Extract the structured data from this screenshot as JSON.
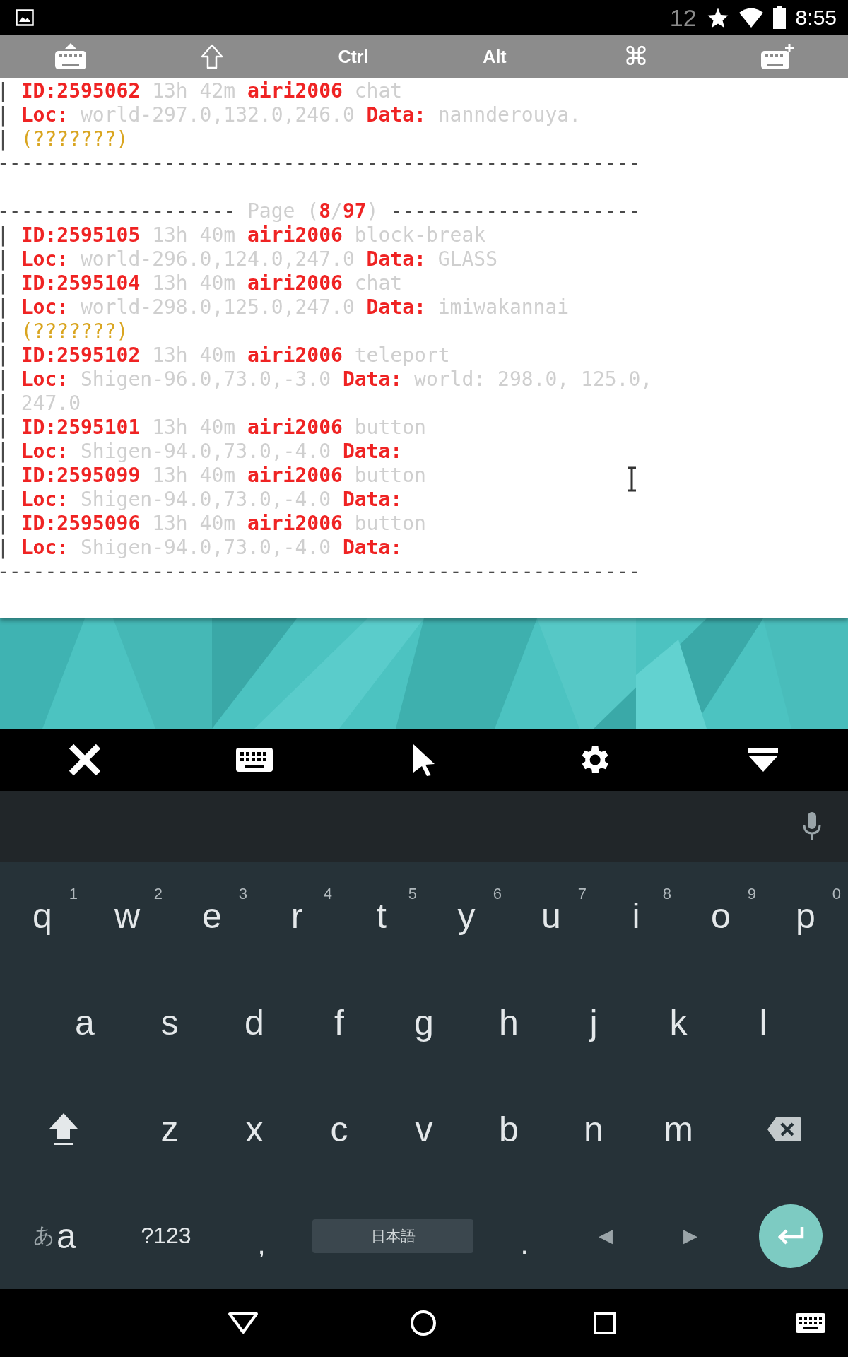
{
  "status_bar": {
    "notification_count": "12",
    "time": "8:55"
  },
  "extra_keys": [
    "Ctrl",
    "Alt",
    "⌘"
  ],
  "terminal": {
    "blocks": [
      {
        "lines": [
          [
            {
              "text": "| ",
              "kind": "bar"
            },
            {
              "text": "ID:2595062",
              "kind": "key"
            },
            {
              "text": " 13h 42m ",
              "kind": "muted"
            },
            {
              "text": "airi2006",
              "kind": "key"
            },
            {
              "text": " chat",
              "kind": "muted"
            }
          ],
          [
            {
              "text": "| ",
              "kind": "bar"
            },
            {
              "text": "Loc:",
              "kind": "key"
            },
            {
              "text": " world-297.0,132.0,246.0 ",
              "kind": "muted"
            },
            {
              "text": "Data:",
              "kind": "key"
            },
            {
              "text": " nannderouya.",
              "kind": "muted"
            }
          ],
          [
            {
              "text": "| ",
              "kind": "bar"
            },
            {
              "text": "(???????)",
              "kind": "warn"
            }
          ],
          [
            {
              "text": "------------------------------------------------------",
              "kind": "rule"
            }
          ]
        ]
      },
      {
        "lines": [
          [
            {
              "text": "--------------------",
              "kind": "rule"
            },
            {
              "text": " Page (",
              "kind": "muted"
            },
            {
              "text": "8",
              "kind": "key"
            },
            {
              "text": "/",
              "kind": "muted"
            },
            {
              "text": "97",
              "kind": "key"
            },
            {
              "text": ") ",
              "kind": "muted"
            },
            {
              "text": "---------------------",
              "kind": "rule"
            }
          ],
          [
            {
              "text": "| ",
              "kind": "bar"
            },
            {
              "text": "ID:2595105",
              "kind": "key"
            },
            {
              "text": " 13h 40m ",
              "kind": "muted"
            },
            {
              "text": "airi2006",
              "kind": "key"
            },
            {
              "text": " block-break",
              "kind": "muted"
            }
          ],
          [
            {
              "text": "| ",
              "kind": "bar"
            },
            {
              "text": "Loc:",
              "kind": "key"
            },
            {
              "text": " world-296.0,124.0,247.0 ",
              "kind": "muted"
            },
            {
              "text": "Data:",
              "kind": "key"
            },
            {
              "text": " GLASS",
              "kind": "muted"
            }
          ],
          [
            {
              "text": "| ",
              "kind": "bar"
            },
            {
              "text": "ID:2595104",
              "kind": "key"
            },
            {
              "text": " 13h 40m ",
              "kind": "muted"
            },
            {
              "text": "airi2006",
              "kind": "key"
            },
            {
              "text": " chat",
              "kind": "muted"
            }
          ],
          [
            {
              "text": "| ",
              "kind": "bar"
            },
            {
              "text": "Loc:",
              "kind": "key"
            },
            {
              "text": " world-298.0,125.0,247.0 ",
              "kind": "muted"
            },
            {
              "text": "Data:",
              "kind": "key"
            },
            {
              "text": " imiwakannai",
              "kind": "muted"
            }
          ],
          [
            {
              "text": "| ",
              "kind": "bar"
            },
            {
              "text": "(???????)",
              "kind": "warn"
            }
          ],
          [
            {
              "text": "| ",
              "kind": "bar"
            },
            {
              "text": "ID:2595102",
              "kind": "key"
            },
            {
              "text": " 13h 40m ",
              "kind": "muted"
            },
            {
              "text": "airi2006",
              "kind": "key"
            },
            {
              "text": " teleport",
              "kind": "muted"
            }
          ],
          [
            {
              "text": "| ",
              "kind": "bar"
            },
            {
              "text": "Loc:",
              "kind": "key"
            },
            {
              "text": " Shigen-96.0,73.0,-3.0 ",
              "kind": "muted"
            },
            {
              "text": "Data:",
              "kind": "key"
            },
            {
              "text": " world: 298.0, 125.0,",
              "kind": "muted"
            }
          ],
          [
            {
              "text": "| ",
              "kind": "bar"
            },
            {
              "text": "247.0",
              "kind": "muted"
            }
          ],
          [
            {
              "text": "| ",
              "kind": "bar"
            },
            {
              "text": "ID:2595101",
              "kind": "key"
            },
            {
              "text": " 13h 40m ",
              "kind": "muted"
            },
            {
              "text": "airi2006",
              "kind": "key"
            },
            {
              "text": " button",
              "kind": "muted"
            }
          ],
          [
            {
              "text": "| ",
              "kind": "bar"
            },
            {
              "text": "Loc:",
              "kind": "key"
            },
            {
              "text": " Shigen-94.0,73.0,-4.0 ",
              "kind": "muted"
            },
            {
              "text": "Data:",
              "kind": "key"
            }
          ],
          [
            {
              "text": "| ",
              "kind": "bar"
            },
            {
              "text": "ID:2595099",
              "kind": "key"
            },
            {
              "text": " 13h 40m ",
              "kind": "muted"
            },
            {
              "text": "airi2006",
              "kind": "key"
            },
            {
              "text": " button",
              "kind": "muted"
            }
          ],
          [
            {
              "text": "| ",
              "kind": "bar"
            },
            {
              "text": "Loc:",
              "kind": "key"
            },
            {
              "text": " Shigen-94.0,73.0,-4.0 ",
              "kind": "muted"
            },
            {
              "text": "Data:",
              "kind": "key"
            }
          ],
          [
            {
              "text": "| ",
              "kind": "bar"
            },
            {
              "text": "ID:2595096",
              "kind": "key"
            },
            {
              "text": " 13h 40m ",
              "kind": "muted"
            },
            {
              "text": "airi2006",
              "kind": "key"
            },
            {
              "text": " button",
              "kind": "muted"
            }
          ],
          [
            {
              "text": "| ",
              "kind": "bar"
            },
            {
              "text": "Loc:",
              "kind": "key"
            },
            {
              "text": " Shigen-94.0,73.0,-4.0 ",
              "kind": "muted"
            },
            {
              "text": "Data:",
              "kind": "key"
            }
          ],
          [
            {
              "text": "------------------------------------------------------",
              "kind": "rule"
            }
          ]
        ]
      }
    ]
  },
  "keyboard": {
    "rows": [
      [
        {
          "kind": "letter",
          "label": "q",
          "hint": "1"
        },
        {
          "kind": "letter",
          "label": "w",
          "hint": "2"
        },
        {
          "kind": "letter",
          "label": "e",
          "hint": "3"
        },
        {
          "kind": "letter",
          "label": "r",
          "hint": "4"
        },
        {
          "kind": "letter",
          "label": "t",
          "hint": "5"
        },
        {
          "kind": "letter",
          "label": "y",
          "hint": "6"
        },
        {
          "kind": "letter",
          "label": "u",
          "hint": "7"
        },
        {
          "kind": "letter",
          "label": "i",
          "hint": "8"
        },
        {
          "kind": "letter",
          "label": "o",
          "hint": "9"
        },
        {
          "kind": "letter",
          "label": "p",
          "hint": "0"
        }
      ],
      [
        {
          "kind": "letter",
          "label": "a"
        },
        {
          "kind": "letter",
          "label": "s"
        },
        {
          "kind": "letter",
          "label": "d"
        },
        {
          "kind": "letter",
          "label": "f"
        },
        {
          "kind": "letter",
          "label": "g"
        },
        {
          "kind": "letter",
          "label": "h"
        },
        {
          "kind": "letter",
          "label": "j"
        },
        {
          "kind": "letter",
          "label": "k"
        },
        {
          "kind": "letter",
          "label": "l"
        }
      ],
      [
        {
          "kind": "shift"
        },
        {
          "kind": "letter",
          "label": "z"
        },
        {
          "kind": "letter",
          "label": "x"
        },
        {
          "kind": "letter",
          "label": "c"
        },
        {
          "kind": "letter",
          "label": "v"
        },
        {
          "kind": "letter",
          "label": "b"
        },
        {
          "kind": "letter",
          "label": "n"
        },
        {
          "kind": "letter",
          "label": "m"
        },
        {
          "kind": "backspace"
        }
      ],
      [
        {
          "kind": "lang",
          "small": "あ",
          "label": "a"
        },
        {
          "kind": "symbols",
          "label": "?123"
        },
        {
          "kind": "char",
          "label": ","
        },
        {
          "kind": "space",
          "label": "日本語"
        },
        {
          "kind": "char",
          "label": "."
        },
        {
          "kind": "arrow",
          "label": "◀"
        },
        {
          "kind": "arrow",
          "label": "▶"
        },
        {
          "kind": "enter"
        }
      ]
    ]
  }
}
